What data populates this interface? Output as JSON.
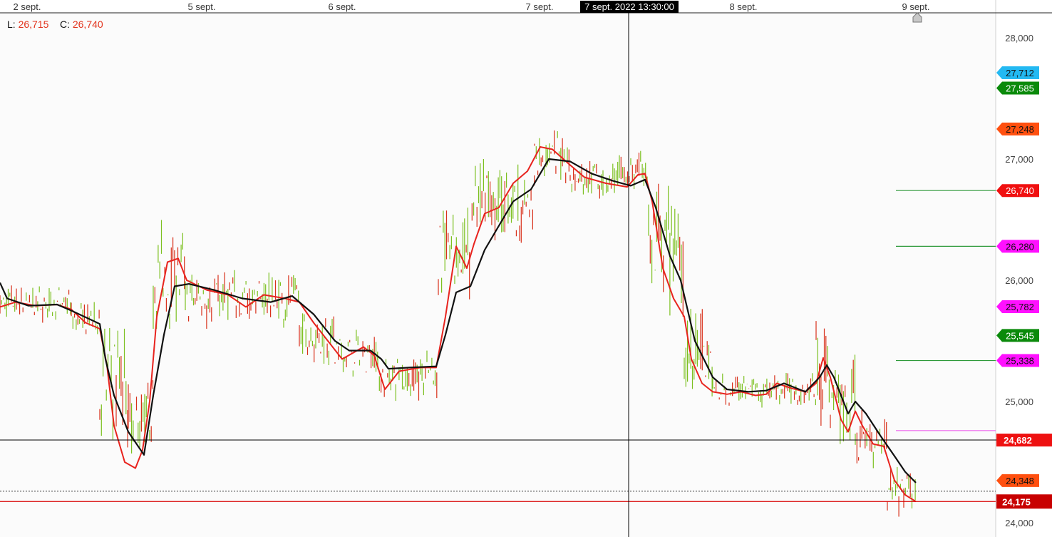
{
  "header": {
    "low_label": "L:",
    "low_value": "26,715",
    "close_label": "C:",
    "close_value": "26,740"
  },
  "crosshair": {
    "time_label": "7 sept. 2022 13:30:00",
    "price_label": "24,682"
  },
  "colors": {
    "up_bar": "#7cc020",
    "down_bar": "#d8301a",
    "fast_ma": "#e8231e",
    "slow_ma": "#111111",
    "current_price": "#d70000",
    "crosshair": "#000000"
  },
  "chart_data": {
    "type": "line",
    "instrument_kind": "intraday price bars with moving averages",
    "x_ticks": [
      "2 sept.",
      "5 sept.",
      "6 sept.",
      "7 sept.",
      "8 sept.",
      "9 sept."
    ],
    "y_ticks": [
      "24,000",
      "25,000",
      "26,000",
      "27,000",
      "28,000"
    ],
    "ylim": [
      23950,
      28250
    ],
    "series": [
      {
        "role": "fast_ma",
        "points": [
          [
            0,
            25780
          ],
          [
            22,
            25820
          ],
          [
            50,
            25790
          ],
          [
            80,
            25800
          ],
          [
            100,
            25760
          ],
          [
            120,
            25650
          ],
          [
            140,
            25600
          ],
          [
            150,
            25300
          ],
          [
            160,
            24800
          ],
          [
            175,
            24500
          ],
          [
            190,
            24450
          ],
          [
            200,
            24600
          ],
          [
            210,
            25000
          ],
          [
            220,
            25700
          ],
          [
            235,
            26150
          ],
          [
            250,
            26180
          ],
          [
            262,
            26000
          ],
          [
            290,
            25920
          ],
          [
            320,
            25880
          ],
          [
            345,
            25780
          ],
          [
            370,
            25880
          ],
          [
            400,
            25850
          ],
          [
            420,
            25820
          ],
          [
            440,
            25650
          ],
          [
            460,
            25500
          ],
          [
            480,
            25350
          ],
          [
            510,
            25450
          ],
          [
            525,
            25380
          ],
          [
            540,
            25100
          ],
          [
            560,
            25250
          ],
          [
            590,
            25280
          ],
          [
            612,
            25280
          ],
          [
            625,
            25700
          ],
          [
            640,
            26280
          ],
          [
            655,
            26100
          ],
          [
            665,
            26300
          ],
          [
            680,
            26550
          ],
          [
            700,
            26600
          ],
          [
            720,
            26800
          ],
          [
            740,
            26900
          ],
          [
            758,
            27100
          ],
          [
            775,
            27080
          ],
          [
            800,
            26950
          ],
          [
            820,
            26850
          ],
          [
            850,
            26800
          ],
          [
            880,
            26770
          ],
          [
            895,
            26870
          ],
          [
            905,
            26880
          ],
          [
            915,
            26650
          ],
          [
            930,
            26100
          ],
          [
            945,
            25850
          ],
          [
            960,
            25700
          ],
          [
            970,
            25350
          ],
          [
            985,
            25150
          ],
          [
            1000,
            25080
          ],
          [
            1020,
            25060
          ],
          [
            1040,
            25080
          ],
          [
            1060,
            25050
          ],
          [
            1075,
            25060
          ],
          [
            1090,
            25150
          ],
          [
            1110,
            25110
          ],
          [
            1130,
            25080
          ],
          [
            1145,
            25150
          ],
          [
            1155,
            25360
          ],
          [
            1165,
            25200
          ],
          [
            1180,
            24850
          ],
          [
            1190,
            24750
          ],
          [
            1200,
            24920
          ],
          [
            1210,
            24800
          ],
          [
            1225,
            24650
          ],
          [
            1240,
            24630
          ],
          [
            1255,
            24350
          ],
          [
            1270,
            24230
          ],
          [
            1285,
            24175
          ]
        ]
      },
      {
        "role": "slow_ma",
        "points": [
          [
            0,
            25980
          ],
          [
            10,
            25850
          ],
          [
            40,
            25790
          ],
          [
            80,
            25800
          ],
          [
            100,
            25750
          ],
          [
            140,
            25640
          ],
          [
            148,
            25350
          ],
          [
            160,
            25050
          ],
          [
            180,
            24750
          ],
          [
            202,
            24560
          ],
          [
            215,
            25050
          ],
          [
            230,
            25550
          ],
          [
            245,
            25950
          ],
          [
            265,
            25970
          ],
          [
            300,
            25920
          ],
          [
            340,
            25850
          ],
          [
            380,
            25820
          ],
          [
            410,
            25870
          ],
          [
            440,
            25720
          ],
          [
            470,
            25500
          ],
          [
            490,
            25420
          ],
          [
            520,
            25420
          ],
          [
            535,
            25350
          ],
          [
            545,
            25270
          ],
          [
            575,
            25280
          ],
          [
            612,
            25290
          ],
          [
            625,
            25550
          ],
          [
            640,
            25900
          ],
          [
            660,
            25950
          ],
          [
            680,
            26250
          ],
          [
            700,
            26450
          ],
          [
            720,
            26650
          ],
          [
            745,
            26750
          ],
          [
            770,
            27000
          ],
          [
            800,
            26980
          ],
          [
            830,
            26880
          ],
          [
            860,
            26820
          ],
          [
            885,
            26780
          ],
          [
            905,
            26830
          ],
          [
            920,
            26600
          ],
          [
            940,
            26200
          ],
          [
            955,
            26000
          ],
          [
            975,
            25500
          ],
          [
            1000,
            25200
          ],
          [
            1020,
            25100
          ],
          [
            1050,
            25080
          ],
          [
            1075,
            25090
          ],
          [
            1100,
            25150
          ],
          [
            1130,
            25080
          ],
          [
            1150,
            25200
          ],
          [
            1160,
            25300
          ],
          [
            1170,
            25200
          ],
          [
            1190,
            24900
          ],
          [
            1200,
            25000
          ],
          [
            1215,
            24900
          ],
          [
            1235,
            24720
          ],
          [
            1255,
            24550
          ],
          [
            1270,
            24420
          ],
          [
            1285,
            24330
          ]
        ]
      }
    ],
    "bar_zones": [
      [
        0,
        100,
        25650,
        25960
      ],
      [
        100,
        140,
        25550,
        25820
      ],
      [
        140,
        180,
        24600,
        25700
      ],
      [
        180,
        215,
        24500,
        25200
      ],
      [
        215,
        260,
        25600,
        26500
      ],
      [
        260,
        420,
        25600,
        26100
      ],
      [
        420,
        470,
        25300,
        25800
      ],
      [
        470,
        530,
        25200,
        25600
      ],
      [
        530,
        615,
        25000,
        25420
      ],
      [
        615,
        660,
        25750,
        26750
      ],
      [
        660,
        750,
        26250,
        27000
      ],
      [
        750,
        800,
        26800,
        27250
      ],
      [
        800,
        885,
        26650,
        27050
      ],
      [
        885,
        910,
        26700,
        27100
      ],
      [
        910,
        960,
        25700,
        26800
      ],
      [
        960,
        1000,
        24900,
        25800
      ],
      [
        1000,
        1080,
        24950,
        25250
      ],
      [
        1080,
        1145,
        24950,
        25250
      ],
      [
        1145,
        1165,
        24800,
        25750
      ],
      [
        1165,
        1200,
        24550,
        25400
      ],
      [
        1200,
        1245,
        24450,
        24950
      ],
      [
        1245,
        1285,
        24050,
        24550
      ]
    ],
    "price_labels": [
      {
        "value": 27712,
        "text": "27,712",
        "color": "#23b9f2",
        "text_color": "#111111",
        "line": false
      },
      {
        "value": 27585,
        "text": "27,585",
        "color": "#0b8a0b",
        "text_color": "#ffffff",
        "line": false
      },
      {
        "value": 27248,
        "text": "27,248",
        "color": "#ff5010",
        "text_color": "#111111",
        "line": false
      },
      {
        "value": 26740,
        "text": "26,740",
        "color": "#f01010",
        "text_color": "#ffffff",
        "line": true,
        "line_color": "#2e9a3a"
      },
      {
        "value": 26280,
        "text": "26,280",
        "color": "#ff10ff",
        "text_color": "#111111",
        "line": true,
        "line_color": "#2e9a3a"
      },
      {
        "value": 25782,
        "text": "25,782",
        "color": "#ff10ff",
        "text_color": "#111111",
        "line": false
      },
      {
        "value": 25545,
        "text": "25,545",
        "color": "#0b8a0b",
        "text_color": "#ffffff",
        "line": false
      },
      {
        "value": 25338,
        "text": "25,338",
        "color": "#ff10ff",
        "text_color": "#111111",
        "line": true,
        "line_color": "#2e9a3a"
      },
      {
        "value": 24760,
        "text": "",
        "color": "",
        "text_color": "",
        "line": true,
        "line_color": "#ee66ee"
      },
      {
        "value": 24348,
        "text": "24,348",
        "color": "#ff5010",
        "text_color": "#111111",
        "line": false
      },
      {
        "value": 24175,
        "text": "24,175",
        "color": "#c80000",
        "text_color": "#ffffff",
        "line": true,
        "line_color": "#d70000"
      }
    ],
    "current_price": 24175,
    "crosshair_price": 24682,
    "dotted_price": 24260
  }
}
